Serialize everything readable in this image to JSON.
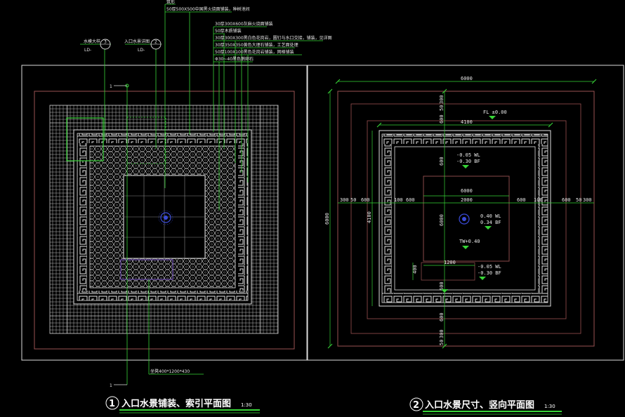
{
  "colors": {
    "background": "#000000",
    "frame": "#dcdcdc",
    "paving": "#c8c8c8",
    "boundary": "#8a4a4a",
    "leader": "#37d437",
    "pond": "#9a8fb0",
    "fountain": "#3a4bd8",
    "marker": "#7a55c8",
    "text": "#ffffff"
  },
  "plan1": {
    "annotations": [
      "筑形",
      "50厚500X500中国黑火烧面铺装，种树池间",
      "30厚300X600灰麻火烧面铺装",
      "50厚木质铺装",
      "30厚300X300黑白色花岗岩，圆钉与水口交接，铺装，见详图",
      "30厚350X350黄色大理石铺装，工艺面处理",
      "50厚100X100黑色花岗岩铺装，网格铺装",
      "Φ30~40黑色鹅卵石"
    ],
    "callout_a": {
      "label": "水模大样",
      "number": "3",
      "ref": "LD-"
    },
    "callout_b": {
      "label": "入口水景详图",
      "number": "2",
      "ref": "LD-"
    },
    "section_mark_top": "1",
    "section_mark_bottom": "1",
    "bench_note": "坐凳400*1200*430",
    "title_number": "1",
    "title": "入口水景铺装、索引平面图",
    "scale": "1:30"
  },
  "plan2": {
    "dims_top": [
      "6000",
      "4100",
      "6000"
    ],
    "dims_row": [
      "300",
      "50",
      "600",
      "100",
      "600",
      "2000",
      "600",
      "100",
      "600",
      "50",
      "300"
    ],
    "dims_left": [
      "6000",
      "4100"
    ],
    "dims_vert": [
      "300",
      "50",
      "600",
      "600",
      "6000",
      "600",
      "600",
      "300",
      "50"
    ],
    "dim_small": [
      "400",
      "1200"
    ],
    "fl": "FL ±0.00",
    "levels_upper": [
      "-0.05 WL",
      "-0.30 BF"
    ],
    "levels_center": [
      "0.40 WL",
      "0.34 BF"
    ],
    "tw": "TW+0.40",
    "levels_lower": [
      "-0.05 WL",
      "-0.30 BF"
    ],
    "title_number": "2",
    "title": "入口水景尺寸、竖向平面图",
    "scale": "1:30"
  }
}
